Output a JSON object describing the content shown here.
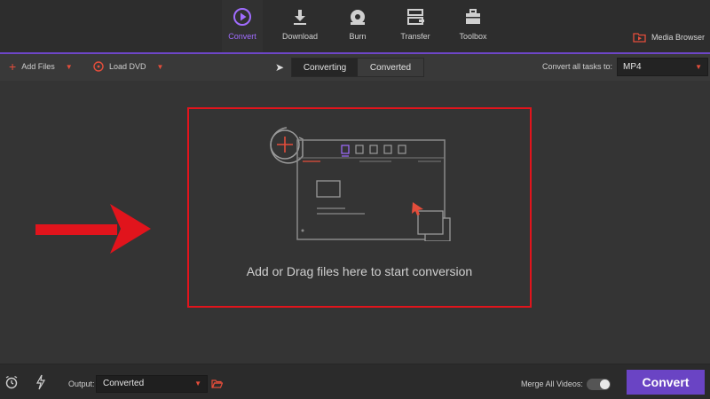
{
  "nav": {
    "items": [
      {
        "label": "Convert",
        "icon": "play-circle-icon"
      },
      {
        "label": "Download",
        "icon": "download-icon"
      },
      {
        "label": "Burn",
        "icon": "disc-icon"
      },
      {
        "label": "Transfer",
        "icon": "transfer-icon"
      },
      {
        "label": "Toolbox",
        "icon": "toolbox-icon"
      }
    ],
    "active": "Convert",
    "media_browser": "Media Browser"
  },
  "toolbar": {
    "add_files": "Add Files",
    "load_dvd": "Load DVD",
    "tabs": [
      "Converting",
      "Converted"
    ],
    "active_tab": "Converting",
    "convert_all_label": "Convert all tasks to:",
    "format_value": "MP4"
  },
  "main": {
    "drop_text": "Add or Drag files here to start conversion"
  },
  "bottom": {
    "output_label": "Output:",
    "output_value": "Converted",
    "merge_label": "Merge All Videos:",
    "merge_enabled": false,
    "convert_button": "Convert"
  },
  "colors": {
    "accent": "#6a44c4",
    "highlight_red": "#e1141c",
    "icon_red": "#e44d3b"
  }
}
